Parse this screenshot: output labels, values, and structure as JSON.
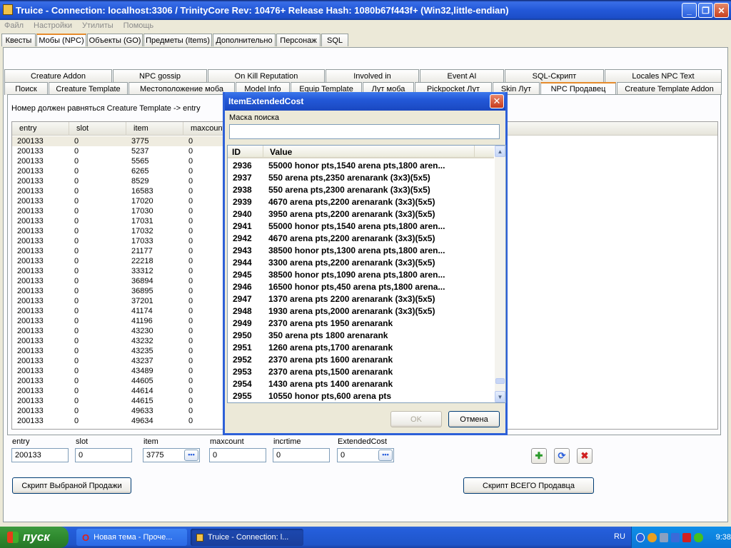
{
  "window": {
    "title": "Truice - Connection: localhost:3306 / TrinityCore Rev: 10476+ Release Hash: 1080b67f443f+ (Win32,little-endian)"
  },
  "menu": [
    "Файл",
    "Настройки",
    "Утилиты",
    "Помощь"
  ],
  "main_tabs": [
    "Квесты",
    "Мобы (NPC)",
    "Объекты (GO)",
    "Предметы (Items)",
    "Дополнительно",
    "Персонаж",
    "SQL"
  ],
  "sub_tabs_top": [
    "Creature Addon",
    "NPC gossip",
    "On Kill Reputation",
    "Involved in",
    "Event AI",
    "SQL-Скрипт",
    "Locales NPC Text"
  ],
  "sub_tabs_bottom": [
    "Поиск",
    "Creature Template",
    "Местоположение моба",
    "Model Info",
    "Equip Template",
    "Лут моба",
    "Pickpocket Лут",
    "Skin Лут",
    "NPC Продавец",
    "Creature Template Addon"
  ],
  "hint": "Номер должен равняться Creature Template -> entry",
  "grid": {
    "columns": [
      "entry",
      "slot",
      "item",
      "maxcount"
    ],
    "rows": [
      [
        "200133",
        "0",
        "3775",
        "0"
      ],
      [
        "200133",
        "0",
        "5237",
        "0"
      ],
      [
        "200133",
        "0",
        "5565",
        "0"
      ],
      [
        "200133",
        "0",
        "6265",
        "0"
      ],
      [
        "200133",
        "0",
        "8529",
        "0"
      ],
      [
        "200133",
        "0",
        "16583",
        "0"
      ],
      [
        "200133",
        "0",
        "17020",
        "0"
      ],
      [
        "200133",
        "0",
        "17030",
        "0"
      ],
      [
        "200133",
        "0",
        "17031",
        "0"
      ],
      [
        "200133",
        "0",
        "17032",
        "0"
      ],
      [
        "200133",
        "0",
        "17033",
        "0"
      ],
      [
        "200133",
        "0",
        "21177",
        "0"
      ],
      [
        "200133",
        "0",
        "22218",
        "0"
      ],
      [
        "200133",
        "0",
        "33312",
        "0"
      ],
      [
        "200133",
        "0",
        "36894",
        "0"
      ],
      [
        "200133",
        "0",
        "36895",
        "0"
      ],
      [
        "200133",
        "0",
        "37201",
        "0"
      ],
      [
        "200133",
        "0",
        "41174",
        "0"
      ],
      [
        "200133",
        "0",
        "41196",
        "0"
      ],
      [
        "200133",
        "0",
        "43230",
        "0"
      ],
      [
        "200133",
        "0",
        "43232",
        "0"
      ],
      [
        "200133",
        "0",
        "43235",
        "0"
      ],
      [
        "200133",
        "0",
        "43237",
        "0"
      ],
      [
        "200133",
        "0",
        "43489",
        "0"
      ],
      [
        "200133",
        "0",
        "44605",
        "0"
      ],
      [
        "200133",
        "0",
        "44614",
        "0"
      ],
      [
        "200133",
        "0",
        "44615",
        "0"
      ],
      [
        "200133",
        "0",
        "49633",
        "0"
      ],
      [
        "200133",
        "0",
        "49634",
        "0"
      ]
    ]
  },
  "fields": {
    "entry": {
      "label": "entry",
      "value": "200133"
    },
    "slot": {
      "label": "slot",
      "value": "0"
    },
    "item": {
      "label": "item",
      "value": "3775"
    },
    "maxcount": {
      "label": "maxcount",
      "value": "0"
    },
    "incrtime": {
      "label": "incrtime",
      "value": "0"
    },
    "extendedcost": {
      "label": "ExtendedCost",
      "value": "0"
    }
  },
  "buttons": {
    "script_selected": "Скрипт Выбраной Продажи",
    "script_all": "Скрипт ВСЕГО Продавца",
    "dots": "•••"
  },
  "dialog": {
    "title": "ItemExtendedCost",
    "search_label": "Маска поиска",
    "search_value": "",
    "columns": [
      "ID",
      "Value"
    ],
    "rows": [
      [
        "2936",
        "55000 honor pts,1540 arena pts,1800 aren..."
      ],
      [
        "2937",
        "550 arena pts,2350 arenarank (3x3)(5x5)"
      ],
      [
        "2938",
        "550 arena pts,2300 arenarank (3x3)(5x5)"
      ],
      [
        "2939",
        "4670 arena pts,2200 arenarank (3x3)(5x5)"
      ],
      [
        "2940",
        "3950 arena pts,2200 arenarank (3x3)(5x5)"
      ],
      [
        "2941",
        "55000 honor pts,1540 arena pts,1800 aren..."
      ],
      [
        "2942",
        "4670 arena pts,2200 arenarank (3x3)(5x5)"
      ],
      [
        "2943",
        "38500 honor pts,1300 arena pts,1800 aren..."
      ],
      [
        "2944",
        "3300 arena pts,2200 arenarank (3x3)(5x5)"
      ],
      [
        "2945",
        "38500 honor pts,1090 arena pts,1800 aren..."
      ],
      [
        "2946",
        "16500 honor pts,450 arena pts,1800 arena..."
      ],
      [
        "2947",
        "1370 arena pts 2200 arenarank (3x3)(5x5)"
      ],
      [
        "2948",
        "1930 arena pts,2000 arenarank (3x3)(5x5)"
      ],
      [
        "2949",
        "2370 arena pts 1950 arenarank"
      ],
      [
        "2950",
        "350 arena pts 1800 arenarank"
      ],
      [
        "2951",
        "1260 arena pts,1700 arenarank"
      ],
      [
        "2952",
        "2370 arena pts 1600 arenarank"
      ],
      [
        "2953",
        "2370 arena pts,1500 arenarank"
      ],
      [
        "2954",
        "1430 arena pts 1400 arenarank"
      ],
      [
        "2955",
        "10550 honor pts,600 arena pts"
      ]
    ],
    "ok": "OK",
    "cancel": "Отмена"
  },
  "taskbar": {
    "start": "пуск",
    "tasks": [
      "Новая тема - Проче...",
      "Truice - Connection: l..."
    ],
    "lang": "RU",
    "time": "9:38"
  }
}
